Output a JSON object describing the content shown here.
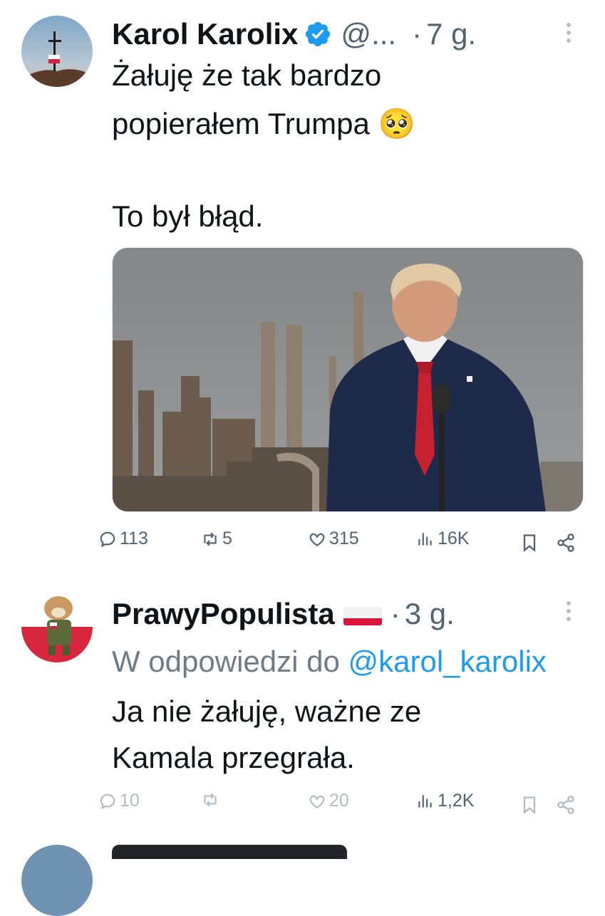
{
  "tweet1": {
    "display_name": "Karol Karolix",
    "handle": "@...",
    "dot": "·",
    "time": "7 g.",
    "text_lines": [
      "Żałuję że tak bardzo",
      "popierałem Trumpa 🥺",
      "",
      "To był błąd."
    ],
    "actions": {
      "replies": "113",
      "reposts": "5",
      "likes": "315",
      "views": "16K"
    }
  },
  "tweet2": {
    "display_name": "PrawyPopulista",
    "dot": "·",
    "time": "3 g.",
    "reply_prefix": "W odpowiedzi do ",
    "reply_mention": "@karol_karolix",
    "text_lines": [
      "Ja nie żałuję, ważne ze",
      "Kamala przegrała."
    ],
    "actions": {
      "replies": "10",
      "likes": "20",
      "views": "1,2K"
    }
  },
  "colors": {
    "text": "#0f1419",
    "secondary": "#536471",
    "link": "#1d9bf0",
    "verified": "#1d9bf0"
  }
}
